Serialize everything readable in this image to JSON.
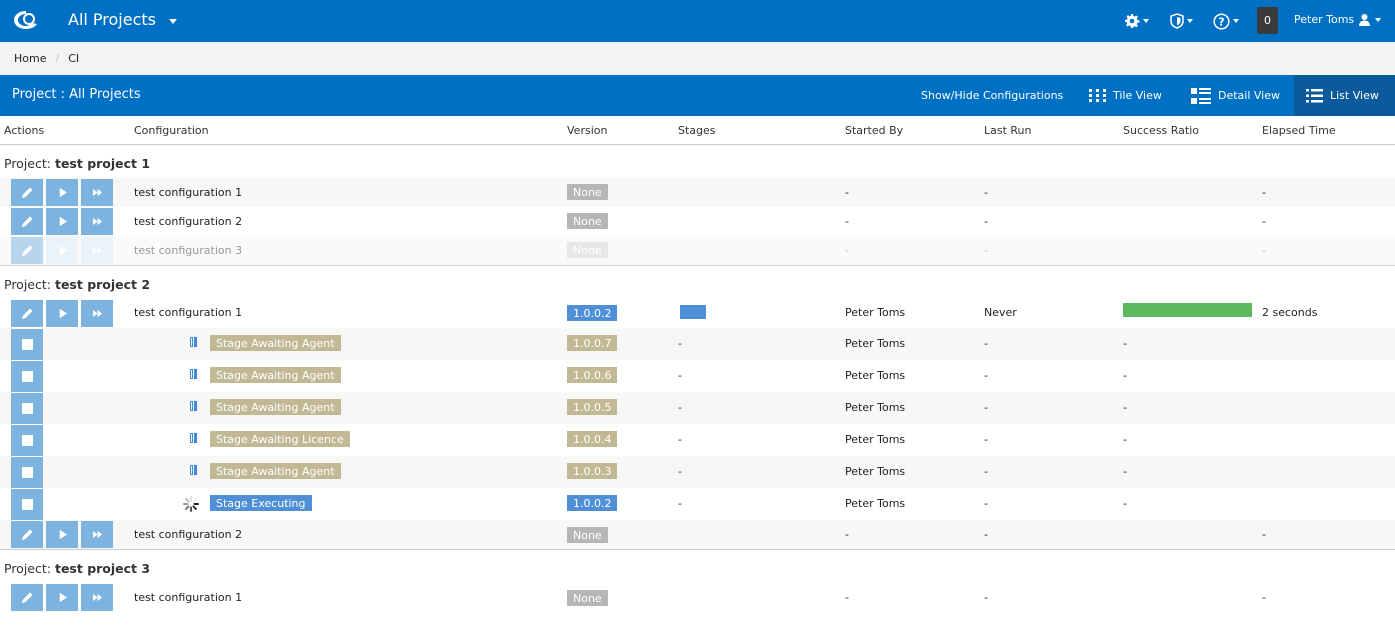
{
  "topbar": {
    "title": "All Projects",
    "icons": [
      "settings-gear-icon",
      "security-shield-icon",
      "help-question-icon"
    ],
    "notification_count": "0",
    "user_name": "Peter Toms"
  },
  "breadcrumb": {
    "items": [
      "Home",
      "CI"
    ],
    "separator": "/"
  },
  "project_bar": {
    "title": "Project : All Projects",
    "show_hide": "Show/Hide Configurations",
    "views": [
      {
        "label": "Tile View",
        "active": false
      },
      {
        "label": "Detail View",
        "active": false
      },
      {
        "label": "List View",
        "active": true
      }
    ]
  },
  "columns": {
    "actions": "Actions",
    "configuration": "Configuration",
    "version": "Version",
    "stages": "Stages",
    "started_by": "Started By",
    "last_run": "Last Run",
    "success_ratio": "Success Ratio",
    "elapsed_time": "Elapsed Time"
  },
  "colors": {
    "brand": "#0070c4",
    "success": "#5cb85c",
    "executing": "#4f8fd8",
    "awaiting": "#c2b894"
  },
  "groups": [
    {
      "prefix": "Project:",
      "name": "test project 1",
      "rows": [
        {
          "config": "test configuration 1",
          "version": "None",
          "started_by": "-",
          "last_run": "-",
          "elapsed": "-"
        },
        {
          "config": "test configuration 2",
          "version": "None",
          "started_by": "-",
          "last_run": "-",
          "elapsed": "-"
        },
        {
          "config": "test configuration 3",
          "version": "None",
          "started_by": "-",
          "last_run": "-",
          "elapsed": "-",
          "disabled": true
        }
      ]
    },
    {
      "prefix": "Project:",
      "name": "test project 2",
      "rows": [
        {
          "config": "test configuration 1",
          "version": "1.0.0.2",
          "started_by": "Peter Toms",
          "last_run": "Never",
          "success_ratio": 1.0,
          "elapsed": "2 seconds"
        },
        {
          "config": "test configuration 2",
          "version": "None",
          "started_by": "-",
          "last_run": "-",
          "elapsed": "-"
        }
      ],
      "stage_rows": [
        {
          "status": "Stage Awaiting Agent",
          "version": "1.0.0.7",
          "stages": "-",
          "started_by": "Peter Toms",
          "last_run": "-",
          "success_ratio": "-"
        },
        {
          "status": "Stage Awaiting Agent",
          "version": "1.0.0.6",
          "stages": "-",
          "started_by": "Peter Toms",
          "last_run": "-",
          "success_ratio": "-"
        },
        {
          "status": "Stage Awaiting Agent",
          "version": "1.0.0.5",
          "stages": "-",
          "started_by": "Peter Toms",
          "last_run": "-",
          "success_ratio": "-"
        },
        {
          "status": "Stage Awaiting Licence",
          "version": "1.0.0.4",
          "stages": "-",
          "started_by": "Peter Toms",
          "last_run": "-",
          "success_ratio": "-"
        },
        {
          "status": "Stage Awaiting Agent",
          "version": "1.0.0.3",
          "stages": "-",
          "started_by": "Peter Toms",
          "last_run": "-",
          "success_ratio": "-"
        },
        {
          "status": "Stage Executing",
          "version": "1.0.0.2",
          "stages": "-",
          "started_by": "Peter Toms",
          "last_run": "-",
          "success_ratio": "-"
        }
      ]
    },
    {
      "prefix": "Project:",
      "name": "test project 3",
      "rows": [
        {
          "config": "test configuration 1",
          "version": "None",
          "started_by": "-",
          "last_run": "-",
          "elapsed": "-"
        }
      ]
    }
  ]
}
